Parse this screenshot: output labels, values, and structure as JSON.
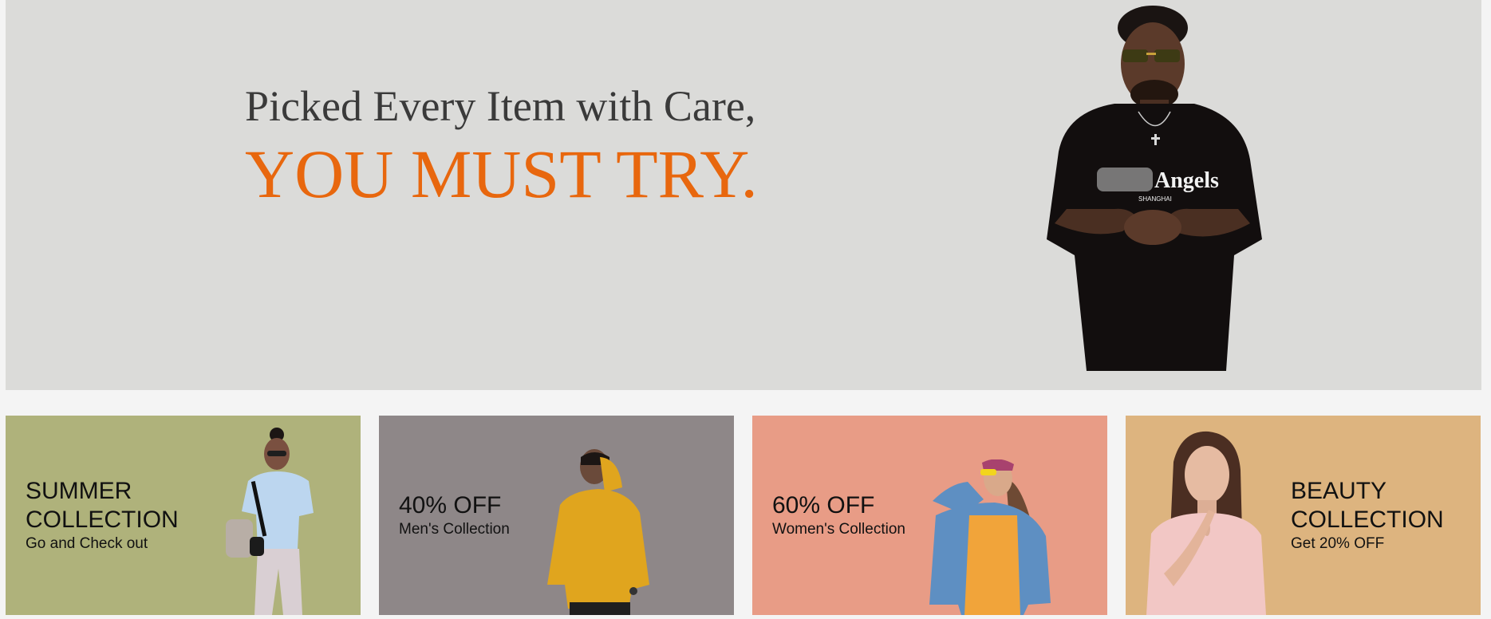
{
  "hero": {
    "line1": "Picked Every Item with Care,",
    "line2": "YOU MUST TRY.",
    "image_icon": "man-black-tshirt-photo"
  },
  "cards": [
    {
      "title_line1": "SUMMER",
      "title_line2": "COLLECTION",
      "subtitle": "Go and Check out",
      "image_icon": "woman-backpack-photo",
      "background": "#afb27b"
    },
    {
      "title": "40% OFF",
      "subtitle": "Men's Collection",
      "image_icon": "man-yellow-hoodie-photo",
      "background": "#8e8788"
    },
    {
      "title": "60% OFF",
      "subtitle": "Women's Collection",
      "image_icon": "woman-denim-jacket-photo",
      "background": "#e89c86"
    },
    {
      "title_line1": "BEAUTY",
      "title_line2": "COLLECTION",
      "subtitle": "Get 20% OFF",
      "image_icon": "woman-pink-blouse-photo",
      "background": "#ddb47f"
    }
  ],
  "colors": {
    "accent": "#e8670e",
    "hero_bg": "#dbdbd9",
    "page_bg": "#f4f4f4"
  }
}
